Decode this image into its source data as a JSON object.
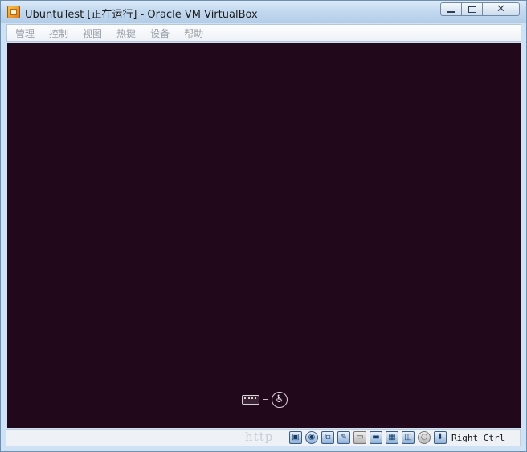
{
  "window": {
    "title": "UbuntuTest [正在运行] - Oracle VM VirtualBox",
    "controls": {
      "minimize": "▬",
      "maximize": "☐",
      "close": "✕"
    }
  },
  "menu": {
    "items": [
      {
        "label": "管理"
      },
      {
        "label": "控制"
      },
      {
        "label": "视图"
      },
      {
        "label": "热键"
      },
      {
        "label": "设备"
      },
      {
        "label": "帮助"
      }
    ]
  },
  "vm_screen": {
    "background": "#22081b",
    "accessibility": {
      "equals": "=",
      "person_glyph": "♿"
    }
  },
  "statusbar": {
    "watermark": "http",
    "tray_icons": [
      {
        "name": "hard-disk-icon",
        "glyph": "▣"
      },
      {
        "name": "optical-drive-icon",
        "glyph": "◉"
      },
      {
        "name": "network-icon",
        "glyph": "⧉"
      },
      {
        "name": "usb-icon",
        "glyph": "✎"
      },
      {
        "name": "shared-folder-icon",
        "glyph": "▭"
      },
      {
        "name": "display-icon",
        "glyph": "▬"
      },
      {
        "name": "video-capture-icon",
        "glyph": "▦"
      },
      {
        "name": "mouse-integration-icon",
        "glyph": "◫"
      },
      {
        "name": "cpu-icon",
        "glyph": "◌"
      },
      {
        "name": "keyboard-capture-icon",
        "glyph": "⬇"
      }
    ],
    "host_key": "Right Ctrl"
  }
}
